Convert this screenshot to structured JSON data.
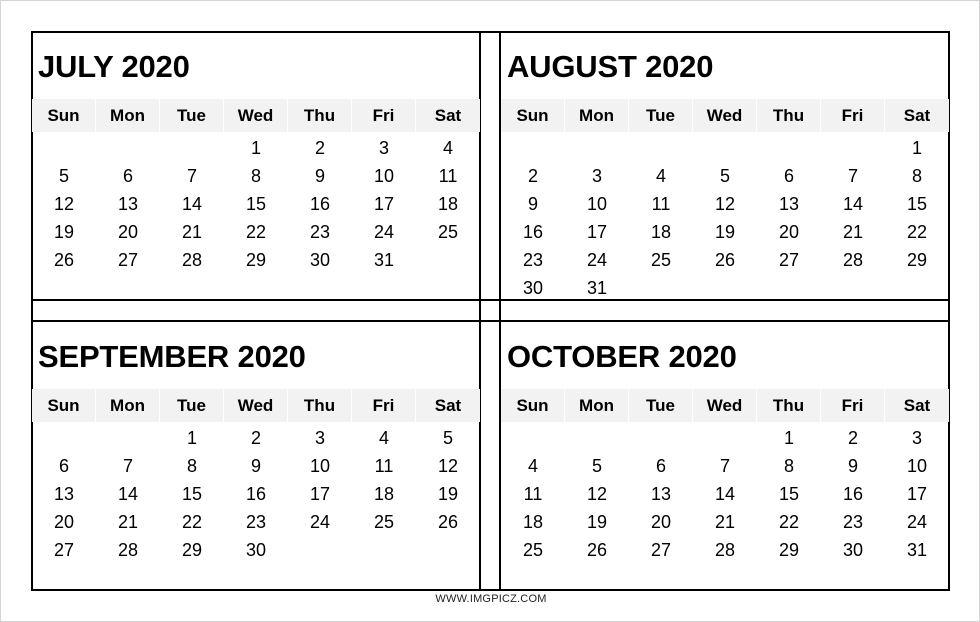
{
  "weekday_labels": [
    "Sun",
    "Mon",
    "Tue",
    "Wed",
    "Thu",
    "Fri",
    "Sat"
  ],
  "calendars": [
    {
      "title": "JULY 2020",
      "weeks": [
        [
          "",
          "",
          "",
          "1",
          "2",
          "3",
          "4"
        ],
        [
          "5",
          "6",
          "7",
          "8",
          "9",
          "10",
          "11"
        ],
        [
          "12",
          "13",
          "14",
          "15",
          "16",
          "17",
          "18"
        ],
        [
          "19",
          "20",
          "21",
          "22",
          "23",
          "24",
          "25"
        ],
        [
          "26",
          "27",
          "28",
          "29",
          "30",
          "31",
          ""
        ]
      ]
    },
    {
      "title": "AUGUST 2020",
      "weeks": [
        [
          "",
          "",
          "",
          "",
          "",
          "",
          "1"
        ],
        [
          "2",
          "3",
          "4",
          "5",
          "6",
          "7",
          "8"
        ],
        [
          "9",
          "10",
          "11",
          "12",
          "13",
          "14",
          "15"
        ],
        [
          "16",
          "17",
          "18",
          "19",
          "20",
          "21",
          "22"
        ],
        [
          "23",
          "24",
          "25",
          "26",
          "27",
          "28",
          "29"
        ],
        [
          "30",
          "31",
          "",
          "",
          "",
          "",
          ""
        ]
      ]
    },
    {
      "title": "SEPTEMBER 2020",
      "weeks": [
        [
          "",
          "",
          "1",
          "2",
          "3",
          "4",
          "5"
        ],
        [
          "6",
          "7",
          "8",
          "9",
          "10",
          "11",
          "12"
        ],
        [
          "13",
          "14",
          "15",
          "16",
          "17",
          "18",
          "19"
        ],
        [
          "20",
          "21",
          "22",
          "23",
          "24",
          "25",
          "26"
        ],
        [
          "27",
          "28",
          "29",
          "30",
          "",
          "",
          ""
        ]
      ]
    },
    {
      "title": "OCTOBER 2020",
      "weeks": [
        [
          "",
          "",
          "",
          "",
          "1",
          "2",
          "3"
        ],
        [
          "4",
          "5",
          "6",
          "7",
          "8",
          "9",
          "10"
        ],
        [
          "11",
          "12",
          "13",
          "14",
          "15",
          "16",
          "17"
        ],
        [
          "18",
          "19",
          "20",
          "21",
          "22",
          "23",
          "24"
        ],
        [
          "25",
          "26",
          "27",
          "28",
          "29",
          "30",
          "31"
        ]
      ]
    }
  ],
  "footer": {
    "watermark": "WWW.IMGPICZ.COM"
  },
  "colors": {
    "header_bg": "#f2f2f2",
    "border": "#000000",
    "page_border": "#d4d4d4"
  }
}
